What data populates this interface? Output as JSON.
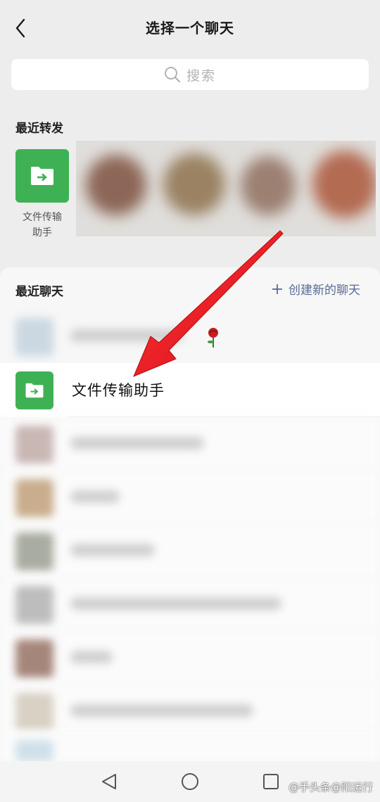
{
  "header": {
    "title": "选择一个聊天"
  },
  "search": {
    "placeholder": "搜索"
  },
  "recent_forward": {
    "label": "最近转发",
    "items": [
      {
        "name_line1": "文件传输",
        "name_line2": "助手",
        "icon": "file-transfer-icon"
      }
    ]
  },
  "recent_chats": {
    "label": "最近聊天",
    "create_label": "创建新的聊天",
    "selected_contact": {
      "name": "文件传输助手",
      "icon": "file-transfer-icon"
    }
  },
  "watermark": "@手头条@阳运行",
  "colors": {
    "accent_green": "#3fb155",
    "link_blue": "#576b95",
    "arrow_red": "#e8121c"
  }
}
